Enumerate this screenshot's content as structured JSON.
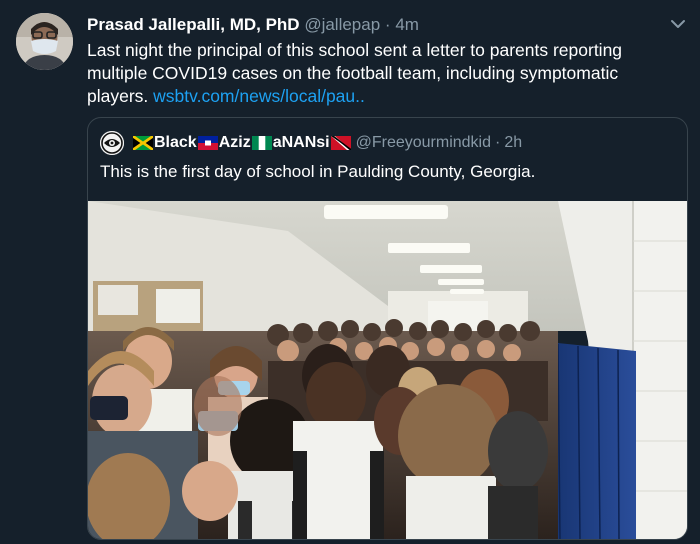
{
  "tweet": {
    "author_name": "Prasad Jallepalli, MD, PhD",
    "author_handle": "@jallepap",
    "separator": "·",
    "time": "4m",
    "text": "Last night the principal of this school sent a letter to parents reporting multiple COVID19 cases on the football team, including symptomatic players.",
    "link": "wsbtv.com/news/local/pau..",
    "avatar_icon": "person-with-mask-avatar",
    "menu_icon": "chevron-down-icon"
  },
  "quoted": {
    "name_part_1": "Black",
    "name_part_2": "Aziz",
    "name_part_3": "aNANsi",
    "handle": "@Freeyourmindkid",
    "separator": "·",
    "time": "2h",
    "text": "This is the first day of school in Paulding County, Georgia.",
    "flags": [
      "jamaica-flag-icon",
      "haiti-flag-icon",
      "nigeria-flag-icon",
      "trinidad-flag-icon"
    ],
    "avatar_icon": "eye-logo-avatar"
  },
  "photo": {
    "subject": "crowded school hallway with students, ceiling lights and blue lockers",
    "colors": {
      "ceiling": "#dcdcd6",
      "wall": "#e6e6e0",
      "lockers": "#1f3a7a",
      "light": "#fbfbf5"
    }
  }
}
